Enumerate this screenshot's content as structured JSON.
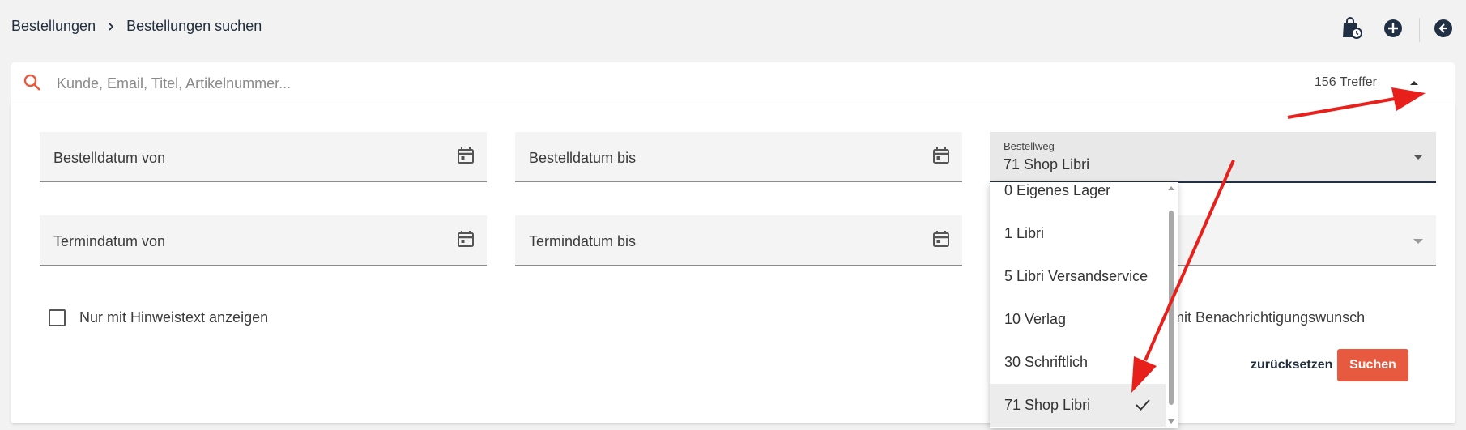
{
  "breadcrumb": {
    "root": "Bestellungen",
    "current": "Bestellungen suchen"
  },
  "search": {
    "placeholder": "Kunde, Email, Titel, Artikelnummer...",
    "value": "",
    "hits": "156 Treffer"
  },
  "filters": {
    "order_date_from": "Bestelldatum von",
    "order_date_to": "Bestelldatum bis",
    "due_date_from": "Termindatum von",
    "due_date_to": "Termindatum bis",
    "order_channel": {
      "label": "Bestellweg",
      "value": "71 Shop Libri"
    },
    "hint_checkbox": "Nur mit Hinweistext anzeigen",
    "notify_text": "mit Benachrichtigungswunsch"
  },
  "dropdown": {
    "options": [
      {
        "label": "0 Eigenes Lager"
      },
      {
        "label": "1 Libri"
      },
      {
        "label": "5 Libri Versandservice"
      },
      {
        "label": "10 Verlag"
      },
      {
        "label": "30 Schriftlich"
      },
      {
        "label": "71 Shop Libri",
        "selected": true
      }
    ]
  },
  "actions": {
    "reset": "zurücksetzen",
    "search": "Suchen"
  },
  "icons": [
    "bag-clock-icon",
    "add-circle-icon",
    "back-circle-icon",
    "search-icon",
    "calendar-icon",
    "chevron-up-icon",
    "dropdown-arrow-icon",
    "check-icon"
  ],
  "colors": {
    "accent": "#e85a3f",
    "dark": "#223045",
    "annotation": "#e8201c"
  }
}
